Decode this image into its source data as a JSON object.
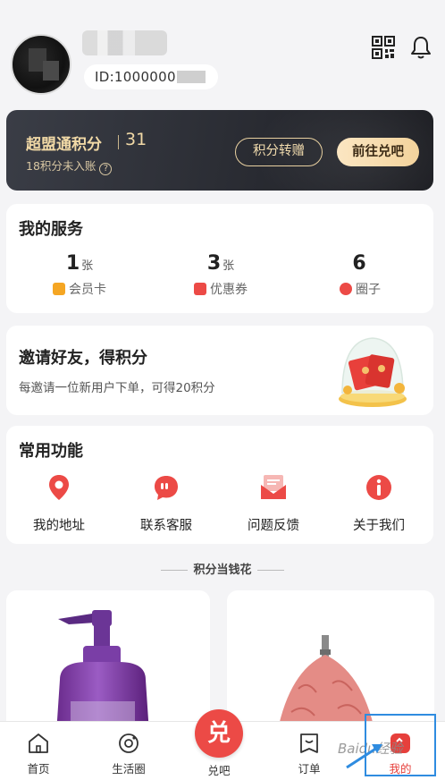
{
  "profile": {
    "id_label": "ID:1000000"
  },
  "points_card": {
    "title": "超盟通积分",
    "points": "31",
    "pending": "18积分未入账",
    "transfer_button": "积分转赠",
    "redeem_button": "前往兑吧"
  },
  "services": {
    "title": "我的服务",
    "items": [
      {
        "count": "1",
        "unit": "张",
        "label": "会员卡",
        "icon": "member-card-icon",
        "color": "#f5a623"
      },
      {
        "count": "3",
        "unit": "张",
        "label": "优惠券",
        "icon": "coupon-icon",
        "color": "#ec4a46"
      },
      {
        "count": "6",
        "unit": "",
        "label": "圈子",
        "icon": "circle-icon",
        "color": "#ec4a46"
      }
    ]
  },
  "invite": {
    "title": "邀请好友，得积分",
    "description": "每邀请一位新用户下单，可得20积分"
  },
  "common_functions": {
    "title": "常用功能",
    "items": [
      {
        "label": "我的地址",
        "icon": "location-icon"
      },
      {
        "label": "联系客服",
        "icon": "chat-icon"
      },
      {
        "label": "问题反馈",
        "icon": "feedback-icon"
      },
      {
        "label": "关于我们",
        "icon": "info-icon"
      }
    ]
  },
  "section_divider": "积分当钱花",
  "tabbar": {
    "items": [
      {
        "label": "首页",
        "icon": "home-icon"
      },
      {
        "label": "生活圈",
        "icon": "life-circle-icon"
      },
      {
        "label": "兑吧",
        "icon": "redeem-icon",
        "glyph": "兑"
      },
      {
        "label": "订单",
        "icon": "order-icon"
      },
      {
        "label": "我的",
        "icon": "profile-icon"
      }
    ],
    "active_index": 4
  },
  "watermark": "Baidu经验",
  "colors": {
    "accent": "#ec4a46",
    "gold": "#f1d9a6",
    "card_dark": "#2a2c33",
    "highlight": "#2f8ce0"
  }
}
